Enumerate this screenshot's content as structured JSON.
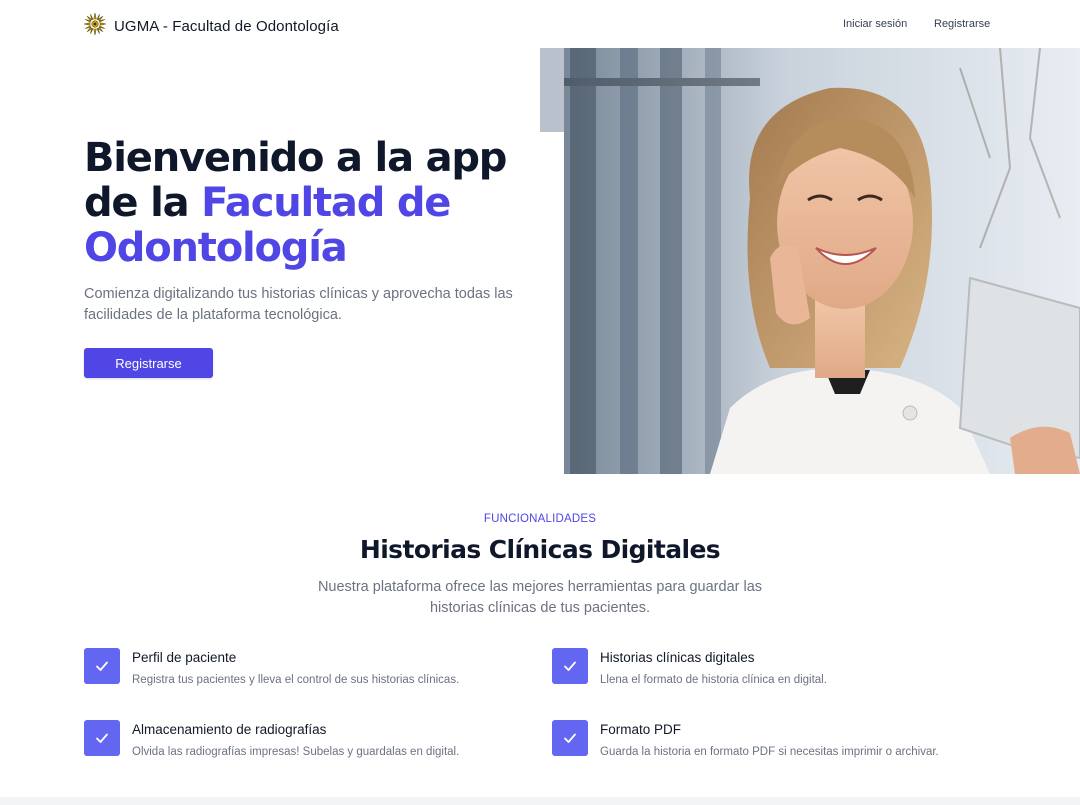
{
  "header": {
    "brand_title": "UGMA - Facultad de Odontología",
    "nav": {
      "login": "Iniciar sesión",
      "register": "Registrarse"
    }
  },
  "hero": {
    "title_line1": "Bienvenido a la app",
    "title_prefix": "de la ",
    "title_accent_1": "Facultad de",
    "title_accent_2": "Odontología",
    "description": "Comienza digitalizando tus historias clínicas y aprovecha todas las facilidades de la plataforma tecnológica.",
    "cta_label": "Registrarse"
  },
  "features_section": {
    "eyebrow": "FUNCIONALIDADES",
    "title": "Historias Clínicas Digitales",
    "description": "Nuestra plataforma ofrece las mejores herramientas para guardar las historias clínicas de tus pacientes.",
    "items": [
      {
        "title": "Perfil de paciente",
        "description": "Registra tus pacientes y lleva el control de sus historias clínicas."
      },
      {
        "title": "Historias clínicas digitales",
        "description": "Llena el formato de historia clínica en digital."
      },
      {
        "title": "Almacenamiento de radiografías",
        "description": "Olvida las radiografías impresas! Subelas y guardalas en digital."
      },
      {
        "title": "Formato PDF",
        "description": "Guarda la historia en formato PDF si necesitas imprimir o archivar."
      }
    ]
  },
  "icons": {
    "logo": "sun-logo-icon",
    "check": "check-icon"
  },
  "colors": {
    "accent": "#4f46e5",
    "check_bg": "#6366f1",
    "heading": "#0f172a",
    "muted": "#6b7280"
  }
}
